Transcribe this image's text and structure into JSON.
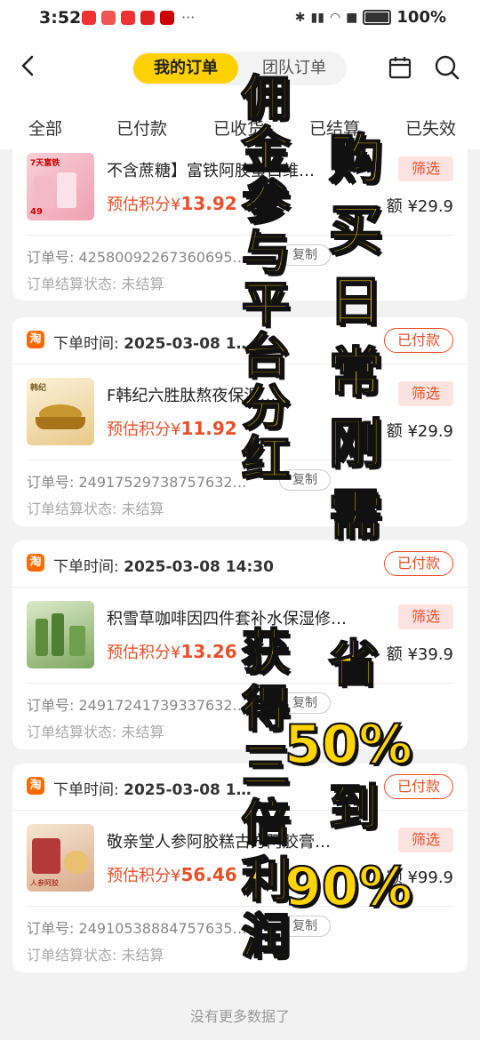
{
  "status_bar": {
    "time": "3:52",
    "more": "···",
    "battery": "100%"
  },
  "header": {
    "tab_active": "我的订单",
    "tab_inactive": "团队订单"
  },
  "tabs": [
    "全部",
    "已付款",
    "已收货",
    "已结算",
    "已失效"
  ],
  "common": {
    "points_label": "预估积分¥",
    "amount_label": "额",
    "filter_label": "筛选",
    "order_no_label": "订单号:",
    "copy_label": "复制",
    "settle_label": "订单结算状态:",
    "settle_value": "未结算",
    "time_label": "下单时间:",
    "platform_icon": "淘"
  },
  "orders": [
    {
      "title": "不含蔗糖】富铁阿胶蛋白维…",
      "points": "13.92",
      "amount": "¥29.9",
      "order_no": "42580092267360695…"
    },
    {
      "time": "2025-03-08 1…",
      "status": "已付款",
      "title": "F韩纪六胜肽熬夜保湿…",
      "points": "11.92",
      "amount": "¥29.9",
      "order_no": "24917529738757632…"
    },
    {
      "time": "2025-03-08 14:30",
      "status": "已付款",
      "title": "积雪草咖啡因四件套补水保湿修…",
      "points": "13.26",
      "amount": "¥39.9",
      "order_no": "24917241739337632…"
    },
    {
      "time": "2025-03-08 1…",
      "status": "已付款",
      "title": "敬亲堂人参阿胶糕古方阿胶膏…",
      "points": "56.46",
      "amount": "¥99.9",
      "order_no": "24910538884757635…"
    }
  ],
  "footer": {
    "no_more": "没有更多数据了"
  },
  "overlay": {
    "left_text": "佣金参与平台分红",
    "left_text_2": "获得三倍利润",
    "right_text": "购买日常刚需",
    "right_text_2": "省",
    "right_text_3": "50%",
    "right_text_4": "到",
    "right_text_5": "90%"
  },
  "colors": {
    "accent": "#ffd100",
    "price": "#e8502a",
    "overlay_text": "#ffd400"
  }
}
